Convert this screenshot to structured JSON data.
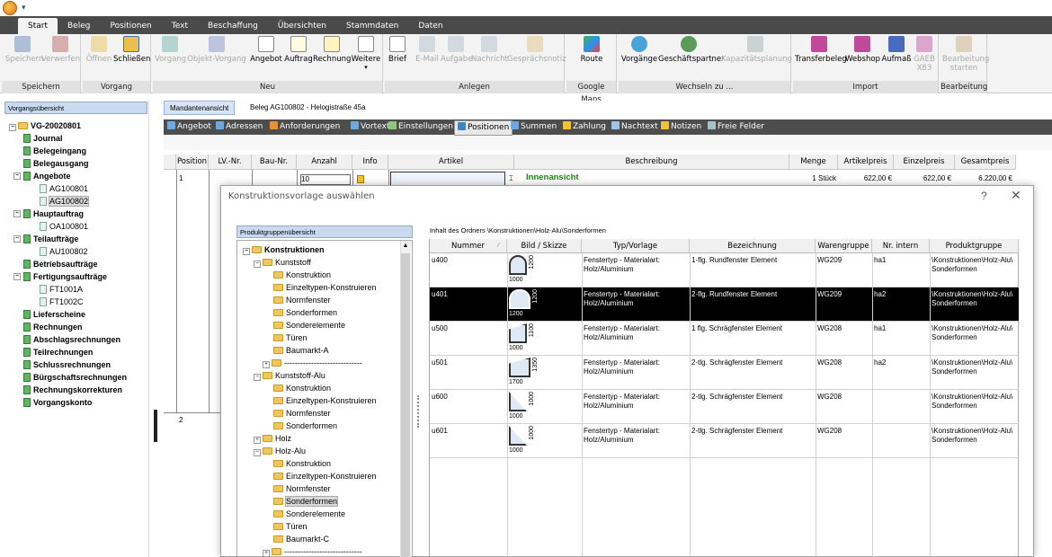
{
  "ribbon_tabs": [
    "Start",
    "Beleg",
    "Positionen",
    "Text",
    "Beschaffung",
    "Übersichten",
    "Stammdaten",
    "Daten"
  ],
  "ribbon": {
    "groups": [
      {
        "label": "Speichern",
        "buttons": [
          {
            "label": "Speichern",
            "enabled": false
          },
          {
            "label": "Verwerfen",
            "enabled": false
          }
        ]
      },
      {
        "label": "Vorgang",
        "buttons": [
          {
            "label": "Öffnen",
            "enabled": false
          },
          {
            "label": "Schließen",
            "enabled": true
          }
        ]
      },
      {
        "label": "Neu",
        "buttons": [
          {
            "label": "Vorgang",
            "enabled": false
          },
          {
            "label": "Objekt-Vorgang",
            "enabled": false
          },
          {
            "label": "Angebot",
            "enabled": true
          },
          {
            "label": "Auftrag",
            "enabled": true
          },
          {
            "label": "Rechnung",
            "enabled": true
          },
          {
            "label": "Weitere",
            "enabled": true
          }
        ]
      },
      {
        "label": "Anlegen",
        "buttons": [
          {
            "label": "Brief",
            "enabled": true
          },
          {
            "label": "E-Mail",
            "enabled": false
          },
          {
            "label": "Aufgabe",
            "enabled": false
          },
          {
            "label": "Nachricht",
            "enabled": false
          },
          {
            "label": "Gesprächsnotiz",
            "enabled": false
          }
        ]
      },
      {
        "label": "Google Maps",
        "buttons": [
          {
            "label": "Route",
            "enabled": true
          }
        ]
      },
      {
        "label": "Wechseln zu ...",
        "buttons": [
          {
            "label": "Vorgänge",
            "enabled": true
          },
          {
            "label": "Geschäftspartner",
            "enabled": true
          },
          {
            "label": "Kapazitätsplanung",
            "enabled": false
          }
        ]
      },
      {
        "label": "Import",
        "buttons": [
          {
            "label": "Transferbeleg",
            "enabled": true
          },
          {
            "label": "Webshop",
            "enabled": true
          },
          {
            "label": "Aufmaß",
            "enabled": true
          },
          {
            "label": "GAEB X83",
            "enabled": false
          }
        ]
      },
      {
        "label": "Bearbeitung",
        "buttons": [
          {
            "label": "Bearbeitung starten",
            "enabled": false
          }
        ]
      }
    ]
  },
  "left_panel": {
    "header": "Vorgangsübersicht",
    "tree": [
      {
        "label": "VG-20020801",
        "level": 0,
        "bold": true
      },
      {
        "label": "Journal",
        "level": 1,
        "bold": true
      },
      {
        "label": "Belegeingang",
        "level": 1,
        "bold": true
      },
      {
        "label": "Belegausgang",
        "level": 1,
        "bold": true
      },
      {
        "label": "Angebote",
        "level": 1,
        "bold": true
      },
      {
        "label": "AG100801",
        "level": 2,
        "bold": false
      },
      {
        "label": "AG100802",
        "level": 2,
        "bold": false,
        "selected": true
      },
      {
        "label": "Hauptauftrag",
        "level": 1,
        "bold": true
      },
      {
        "label": "OA100801",
        "level": 2,
        "bold": false
      },
      {
        "label": "Teilaufträge",
        "level": 1,
        "bold": true
      },
      {
        "label": "AU100802",
        "level": 2,
        "bold": false
      },
      {
        "label": "Betriebsaufträge",
        "level": 1,
        "bold": true
      },
      {
        "label": "Fertigungsaufträge",
        "level": 1,
        "bold": true
      },
      {
        "label": "FT1001A",
        "level": 2,
        "bold": false
      },
      {
        "label": "FT1002C",
        "level": 2,
        "bold": false
      },
      {
        "label": "Lieferscheine",
        "level": 1,
        "bold": true
      },
      {
        "label": "Rechnungen",
        "level": 1,
        "bold": true
      },
      {
        "label": "Abschlagsrechnungen",
        "level": 1,
        "bold": true
      },
      {
        "label": "Teilrechnungen",
        "level": 1,
        "bold": true
      },
      {
        "label": "Schlussrechnungen",
        "level": 1,
        "bold": true
      },
      {
        "label": "Bürgschaftsrechnungen",
        "level": 1,
        "bold": true
      },
      {
        "label": "Rechnungskorrekturen",
        "level": 1,
        "bold": true
      },
      {
        "label": "Vorgangskonto",
        "level": 1,
        "bold": true
      }
    ]
  },
  "main": {
    "mandant_button": "Mandantenansicht",
    "beleg_title": "Beleg AG100802 - Helogistraße 45a",
    "tabs": [
      "Angebot",
      "Adressen",
      "Anforderungen",
      "Vortext",
      "Einstellungen",
      "Positionen",
      "Summen",
      "Zahlung",
      "Nachtext",
      "Notizen",
      "Freie Felder"
    ],
    "active_tab": "Positionen",
    "grid_headers": [
      "Position",
      "LV.-Nr.",
      "Bau-Nr.",
      "Anzahl",
      "Info",
      "Artikel",
      "Beschreibung",
      "Menge",
      "Artikelpreis",
      "Einzelpreis",
      "Gesamtpreis"
    ],
    "rows": [
      {
        "position": "1",
        "anzahl": "10",
        "beschreibung_title": "Innenansicht",
        "menge": "1 Stück",
        "artikelpreis": "622,00 €",
        "einzelpreis": "622,00 €",
        "gesamtpreis": "6.220,00 €"
      },
      {
        "position": "2"
      }
    ]
  },
  "dialog": {
    "title": "Konstruktionsvorlage auswählen",
    "help": "?",
    "close": "✕",
    "tree_header": "Produktgruppenübersicht",
    "folder_path": "Inhalt des Ordners \\Konstruktionen\\Holz-Alu\\Sonderformen",
    "tree": [
      {
        "label": "Konstruktionen",
        "level": 0,
        "bold": true,
        "exp": "−"
      },
      {
        "label": "Kunststoff",
        "level": 1,
        "exp": "−"
      },
      {
        "label": "Konstruktion",
        "level": 2
      },
      {
        "label": "Einzeltypen-Konstruieren",
        "level": 2
      },
      {
        "label": "Normfenster",
        "level": 2
      },
      {
        "label": "Sonderformen",
        "level": 2
      },
      {
        "label": "Sonderelemente",
        "level": 2
      },
      {
        "label": "Türen",
        "level": 2
      },
      {
        "label": "Baumarkt-A",
        "level": 2
      },
      {
        "label": "-----------------------------",
        "level": 2,
        "exp": "+"
      },
      {
        "label": "Kunststoff-Alu",
        "level": 1,
        "exp": "−"
      },
      {
        "label": "Konstruktion",
        "level": 2
      },
      {
        "label": "Einzeltypen-Konstruieren",
        "level": 2
      },
      {
        "label": "Normfenster",
        "level": 2
      },
      {
        "label": "Sonderformen",
        "level": 2
      },
      {
        "label": "Holz",
        "level": 1,
        "exp": "+"
      },
      {
        "label": "Holz-Alu",
        "level": 1,
        "exp": "−"
      },
      {
        "label": "Konstruktion",
        "level": 2
      },
      {
        "label": "Einzeltypen-Konstruieren",
        "level": 2
      },
      {
        "label": "Normfenster",
        "level": 2
      },
      {
        "label": "Sonderformen",
        "level": 2,
        "selected": true
      },
      {
        "label": "Sonderelemente",
        "level": 2
      },
      {
        "label": "Türen",
        "level": 2
      },
      {
        "label": "Baumarkt-C",
        "level": 2
      },
      {
        "label": "-----------------------------",
        "level": 2,
        "exp": "+"
      }
    ],
    "table_headers": [
      "Nummer",
      "Bild / Skizze",
      "Typ/Vorlage",
      "Bezeichnung",
      "Warengruppe",
      "Nr. intern",
      "Produktgruppe"
    ],
    "rows": [
      {
        "nummer": "u400",
        "w": "1000",
        "h": "1200",
        "typ": "Fenstertyp - Materialart:\nHolz/Aluminium",
        "bez": "1-flg. Rundfenster Element",
        "wg": "WG209",
        "nr": "ha1",
        "pg": "\\Konstruktionen\\Holz-Alu\\\nSonderformen",
        "selected": false
      },
      {
        "nummer": "u401",
        "w": "1200",
        "h": "1200",
        "typ": "Fenstertyp - Materialart:\nHolz/Aluminium",
        "bez": "2-flg. Rundfenster Element",
        "wg": "WG209",
        "nr": "ha2",
        "pg": "\\Konstruktionen\\Holz-Alu\\\nSonderformen",
        "selected": true
      },
      {
        "nummer": "u500",
        "w": "1000",
        "h": "1100",
        "typ": "Fenstertyp - Materialart:\nHolz/Aluminium",
        "bez": "1 flg. Schrägfenster Element",
        "wg": "WG208",
        "nr": "ha1",
        "pg": "\\Konstruktionen\\Holz-Alu\\\nSonderformen",
        "selected": false
      },
      {
        "nummer": "u501",
        "w": "1700",
        "h": "1350",
        "typ": "Fenstertyp - Materialart:\nHolz/Aluminium",
        "bez": "2-tlg. Schrägfenster Element",
        "wg": "WG208",
        "nr": "ha2",
        "pg": "\\Konstruktionen\\Holz-Alu\\\nSonderformen",
        "selected": false
      },
      {
        "nummer": "u600",
        "w": "1000",
        "h": "1000",
        "typ": "Fenstertyp - Materialart:\nHolz/Aluminium",
        "bez": "2-tlg. Schrägfenster Element",
        "wg": "WG208",
        "nr": "",
        "pg": "\\Konstruktionen\\Holz-Alu\\\nSonderformen",
        "selected": false
      },
      {
        "nummer": "u601",
        "w": "1000",
        "h": "1000",
        "typ": "Fenstertyp - Materialart:\nHolz/Aluminium",
        "bez": "2-tlg. Schrägfenster Element",
        "wg": "WG208",
        "nr": "",
        "pg": "\\Konstruktionen\\Holz-Alu\\\nSonderformen",
        "selected": false
      }
    ]
  },
  "colors": {
    "menubar": "#4a4a4a",
    "panel_header": "#c8daf0",
    "selected_row": "#000000",
    "accent_green": "#1a8a1a"
  }
}
